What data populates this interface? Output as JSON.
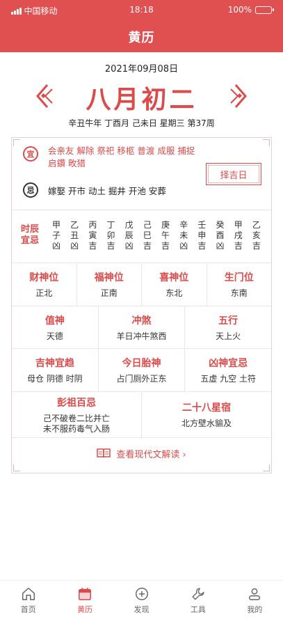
{
  "status": {
    "carrier": "中国移动",
    "time": "18:18",
    "battery": "100%"
  },
  "header": {
    "title": "黄历"
  },
  "date": {
    "solar": "2021年09月08日",
    "lunar": "八月初二",
    "ganzhi": "辛丑牛年 丁酉月 己未日 星期三 第37周"
  },
  "yiji": {
    "yi_badge": "宜",
    "yi_text": "会亲友 解除 祭祀 移柩 普渡 成服 捕捉 启鑽 畋猎",
    "ji_badge": "忌",
    "ji_text": "嫁娶 开市 动土 掘井 开池 安葬",
    "zeji_label": "择吉日"
  },
  "shichen": {
    "label": "时辰宜忌",
    "items": [
      {
        "a": "甲",
        "b": "子",
        "c": "凶"
      },
      {
        "a": "乙",
        "b": "丑",
        "c": "凶"
      },
      {
        "a": "丙",
        "b": "寅",
        "c": "吉"
      },
      {
        "a": "丁",
        "b": "卯",
        "c": "吉"
      },
      {
        "a": "戊",
        "b": "辰",
        "c": "凶"
      },
      {
        "a": "己",
        "b": "巳",
        "c": "吉"
      },
      {
        "a": "庚",
        "b": "午",
        "c": "吉"
      },
      {
        "a": "辛",
        "b": "未",
        "c": "凶"
      },
      {
        "a": "壬",
        "b": "申",
        "c": "吉"
      },
      {
        "a": "癸",
        "b": "酉",
        "c": "凶"
      },
      {
        "a": "甲",
        "b": "戌",
        "c": "吉"
      },
      {
        "a": "乙",
        "b": "亥",
        "c": "吉"
      }
    ]
  },
  "directions": [
    {
      "title": "财神位",
      "value": "正北"
    },
    {
      "title": "福神位",
      "value": "正南"
    },
    {
      "title": "喜神位",
      "value": "东北"
    },
    {
      "title": "生门位",
      "value": "东南"
    }
  ],
  "row3": [
    {
      "title": "值神",
      "value": "天德"
    },
    {
      "title": "冲煞",
      "value": "羊日冲牛煞西"
    },
    {
      "title": "五行",
      "value": "天上火"
    }
  ],
  "row4": [
    {
      "title": "吉神宜趋",
      "value": "母仓 阴德 时阴"
    },
    {
      "title": "今日胎神",
      "value": "占门厕外正东"
    },
    {
      "title": "凶神宜忌",
      "value": "五虚 九空 土符"
    }
  ],
  "row5": [
    {
      "title": "彭祖百忌",
      "value1": "己不破卷二比并亡",
      "value2": "未不服药毒气入肠"
    },
    {
      "title": "二十八星宿",
      "value1": "北方壁水貐及",
      "value2": ""
    }
  ],
  "link": {
    "label": "查看现代文解读 ›"
  },
  "tabs": [
    {
      "label": "首页",
      "icon": "home-icon"
    },
    {
      "label": "黄历",
      "icon": "calendar-icon"
    },
    {
      "label": "发现",
      "icon": "plus-circle-icon"
    },
    {
      "label": "工具",
      "icon": "wrench-icon"
    },
    {
      "label": "我的",
      "icon": "user-icon"
    }
  ],
  "colors": {
    "accent": "#dc4a4a",
    "header_bg": "#e05050"
  }
}
